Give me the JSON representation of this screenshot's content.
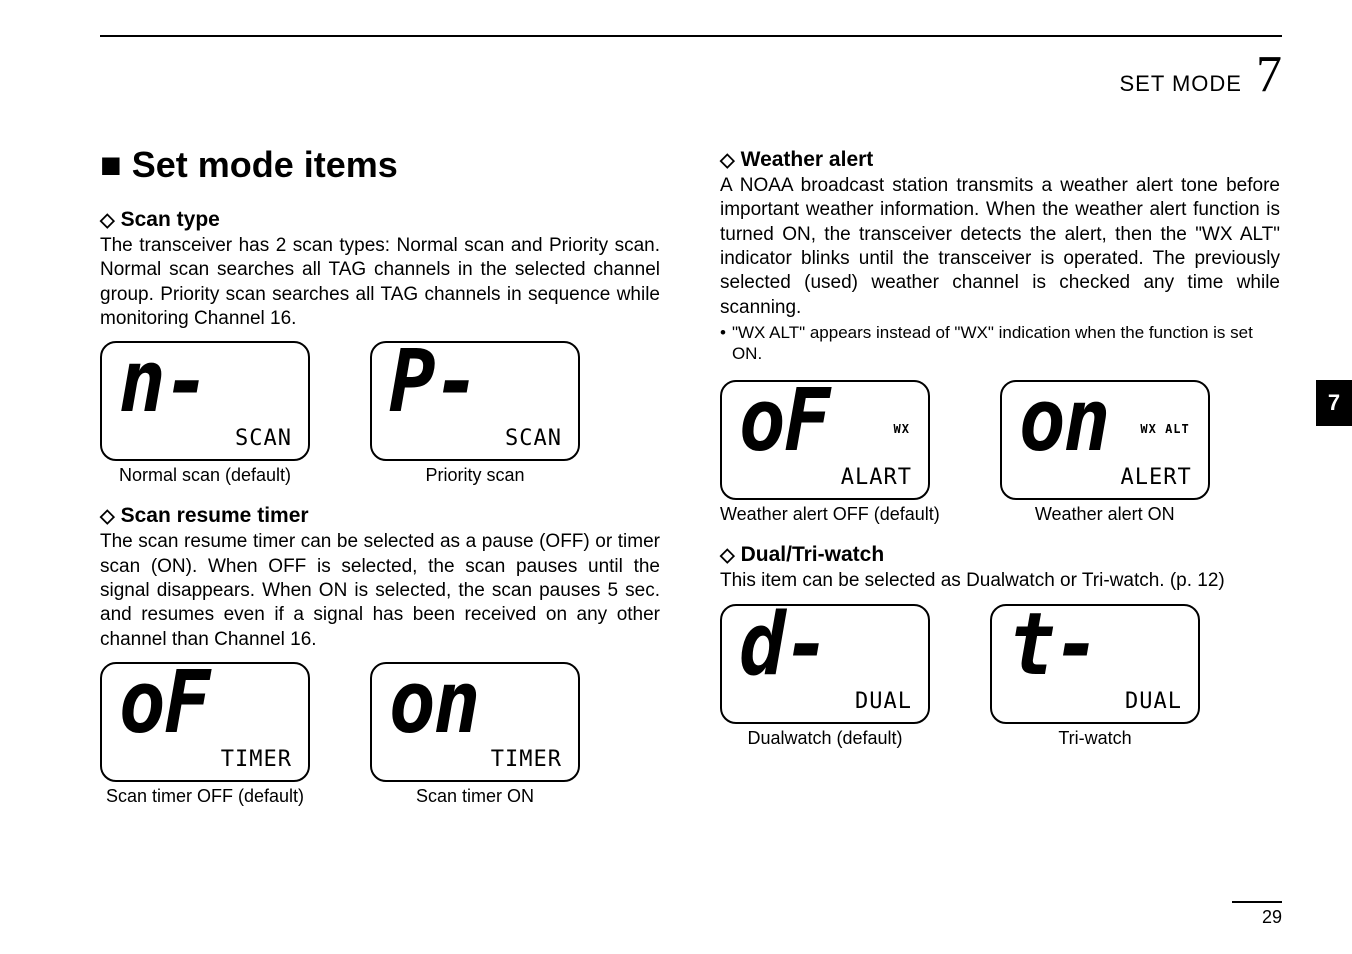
{
  "header": {
    "section": "SET MODE",
    "chapter": "7"
  },
  "side_tab": "7",
  "page_number": "29",
  "title": "■ Set mode items",
  "left": {
    "scan_type": {
      "heading": "Scan type",
      "body": "The transceiver has 2 scan types: Normal scan and Priority scan. Normal scan searches all TAG channels in the selected channel group. Priority scan searches all TAG channels in sequence while monitoring Channel 16.",
      "lcd1_big": "n-",
      "lcd1_small": "SCAN",
      "lcd1_caption": "Normal scan (default)",
      "lcd2_big": "P-",
      "lcd2_small": "SCAN",
      "lcd2_caption": "Priority scan"
    },
    "scan_resume": {
      "heading": "Scan resume timer",
      "body": "The scan resume timer can be selected as a pause (OFF) or timer scan (ON). When OFF is selected, the scan pauses until the signal disappears. When ON is selected, the scan pauses 5 sec. and resumes even if a signal has been received on any other channel than Channel 16.",
      "lcd1_big": "oF",
      "lcd1_small": "TIMER",
      "lcd1_caption": "Scan timer OFF (default)",
      "lcd2_big": "on",
      "lcd2_small": "TIMER",
      "lcd2_caption": "Scan timer ON"
    }
  },
  "right": {
    "wx": {
      "heading": "Weather alert",
      "body": "A NOAA broadcast station transmits a weather alert tone before important weather information. When the weather alert function is turned ON, the transceiver detects the alert, then the \"WX ALT\" indicator blinks until the transceiver is operated. The previously selected (used) weather channel is checked any time while scanning.",
      "bullet": "\"WX ALT\" appears instead of \"WX\" indication when the function is set ON.",
      "lcd1_big": "oF",
      "lcd1_top": "WX",
      "lcd1_small": "ALART",
      "lcd1_caption": "Weather alert OFF (default)",
      "lcd2_big": "on",
      "lcd2_top": "WX ALT",
      "lcd2_small": "ALERT",
      "lcd2_caption": "Weather alert ON"
    },
    "dual": {
      "heading": "Dual/Tri-watch",
      "body": "This item can be selected as Dualwatch or Tri-watch. (p. 12)",
      "lcd1_big": "d-",
      "lcd1_small": "DUAL",
      "lcd1_caption": "Dualwatch (default)",
      "lcd2_big": "t-",
      "lcd2_small": "DUAL",
      "lcd2_caption": "Tri-watch"
    }
  }
}
